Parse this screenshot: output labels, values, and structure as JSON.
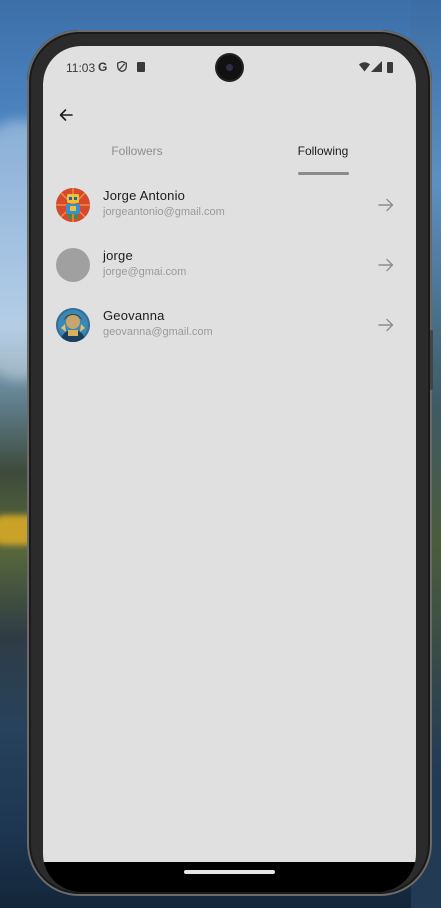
{
  "status_bar": {
    "time": "11:03",
    "google_icon": "G",
    "icons": [
      "google-icon",
      "shield-icon",
      "sim-card-icon",
      "wifi-icon",
      "signal-icon",
      "battery-icon"
    ]
  },
  "header": {
    "back_icon": "arrow-left-icon"
  },
  "tabs": [
    {
      "label": "Followers",
      "selected": false
    },
    {
      "label": "Following",
      "selected": true
    }
  ],
  "users": [
    {
      "name": "Jorge Antonio",
      "email": "jorgeantonio@gmail.com",
      "avatar": "robot-avatar"
    },
    {
      "name": "jorge",
      "email": "jorge@gmai.com",
      "avatar": "placeholder-avatar"
    },
    {
      "name": "Geovanna",
      "email": "geovanna@gmail.com",
      "avatar": "character-avatar"
    }
  ],
  "colors": {
    "screen_background": "#e0e0e0",
    "selected_tab_text": "#1c1c1c",
    "unselected_tab_text": "#8e8e8e",
    "tab_indicator": "#8a8a8a",
    "secondary_text": "#9a9a9a"
  }
}
